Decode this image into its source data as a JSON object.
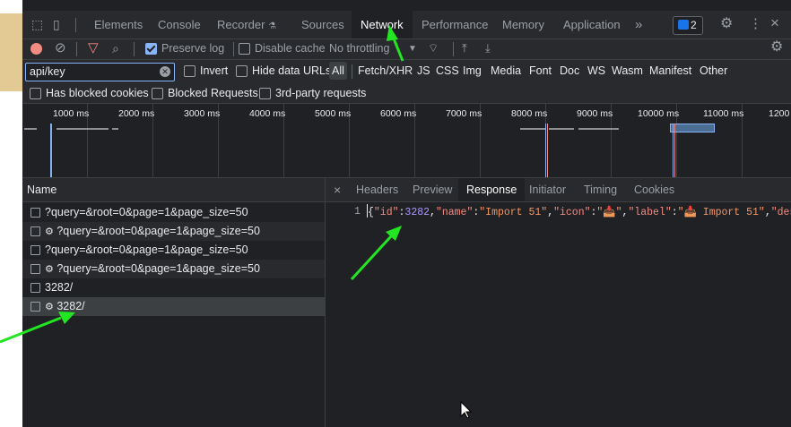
{
  "tabs": {
    "items": [
      "Elements",
      "Console",
      "Recorder",
      "Sources",
      "Network",
      "Performance",
      "Memory",
      "Application"
    ],
    "more": "»",
    "badge_count": "2"
  },
  "toolbar": {
    "preserve_log": "Preserve log",
    "disable_cache": "Disable cache",
    "throttling": "No throttling"
  },
  "filter": {
    "value": "api/key",
    "invert": "Invert",
    "hide_data_urls": "Hide data URLs",
    "types": [
      "All",
      "Fetch/XHR",
      "JS",
      "CSS",
      "Img",
      "Media",
      "Font",
      "Doc",
      "WS",
      "Wasm",
      "Manifest",
      "Other"
    ],
    "has_blocked_cookies": "Has blocked cookies",
    "blocked_requests": "Blocked Requests",
    "third_party": "3rd-party requests"
  },
  "overview": {
    "ticks": [
      "1000 ms",
      "2000 ms",
      "3000 ms",
      "4000 ms",
      "5000 ms",
      "6000 ms",
      "7000 ms",
      "8000 ms",
      "9000 ms",
      "10000 ms",
      "11000 ms",
      "1200"
    ]
  },
  "requests": {
    "header": "Name",
    "rows": [
      {
        "gear": false,
        "name": "?query=&root=0&page=1&page_size=50"
      },
      {
        "gear": true,
        "name": "?query=&root=0&page=1&page_size=50"
      },
      {
        "gear": false,
        "name": "?query=&root=0&page=1&page_size=50"
      },
      {
        "gear": true,
        "name": "?query=&root=0&page=1&page_size=50"
      },
      {
        "gear": false,
        "name": "3282/"
      },
      {
        "gear": true,
        "name": "3282/"
      }
    ]
  },
  "detail": {
    "close": "×",
    "tabs": [
      "Headers",
      "Preview",
      "Response",
      "Initiator",
      "Timing",
      "Cookies"
    ],
    "active_tab": "Response",
    "line_number": "1",
    "response": {
      "open": "{",
      "k_id": "\"id\"",
      "v_id": "3282",
      "k_name": "\"name\"",
      "v_name": "\"Import 51\"",
      "k_icon": "\"icon\"",
      "v_icon": "\"📥\"",
      "k_label": "\"label\"",
      "v_label": "\"📥 Import 51\"",
      "k_desc": "\"descr"
    }
  },
  "colors": {
    "accent": "#8ab4f8",
    "annotation_arrow": "#22e622",
    "record": "#f28b82"
  }
}
